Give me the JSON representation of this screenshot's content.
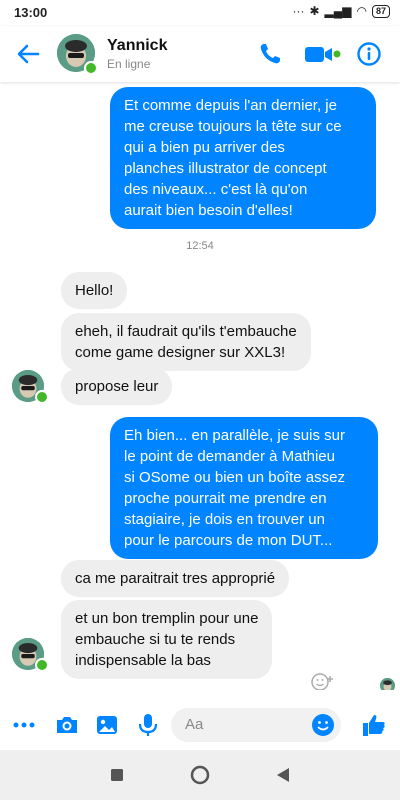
{
  "status_bar": {
    "time": "13:00",
    "battery": "87"
  },
  "header": {
    "contact_name": "Yannick",
    "contact_status": "En ligne"
  },
  "messages": [
    {
      "id": "m1",
      "side": "out",
      "lines": [
        "Et comme depuis l'an dernier, je",
        "me creuse toujours la tête sur ce",
        "qui a bien pu arriver des",
        "planches illustrator de concept",
        "des niveaux... c'est là qu'on",
        "aurait bien besoin d'elles!"
      ]
    },
    {
      "id": "m2",
      "side": "in",
      "lines": [
        "Hello!"
      ]
    },
    {
      "id": "m3",
      "side": "in",
      "lines": [
        "eheh, il faudrait qu'ils t'embauche",
        "come game designer sur XXL3!"
      ]
    },
    {
      "id": "m4",
      "side": "in",
      "lines": [
        "propose leur"
      ]
    },
    {
      "id": "m5",
      "side": "out",
      "lines": [
        "Eh bien... en parallèle, je suis sur",
        "le point de demander à Mathieu",
        "si OSome ou bien un boîte assez",
        "proche pourrait me prendre en",
        "stagiaire, je dois en trouver un",
        "pour le parcours de mon DUT..."
      ]
    },
    {
      "id": "m6",
      "side": "in",
      "lines": [
        "ca me paraitrait tres approprié"
      ]
    },
    {
      "id": "m7",
      "side": "in",
      "lines": [
        "et un bon tremplin pour une",
        "embauche si tu te rends",
        "indispensable la bas"
      ]
    }
  ],
  "timestamp": "12:54",
  "composer": {
    "placeholder": "Aa"
  },
  "colors": {
    "accent": "#0084ff",
    "incoming_bubble": "#eeeeee",
    "online": "#42b72a"
  },
  "icons": {
    "header": [
      "back-arrow-icon",
      "phone-icon",
      "video-icon",
      "info-icon"
    ],
    "composer": [
      "more-icon",
      "camera-icon",
      "gallery-icon",
      "microphone-icon",
      "emoji-icon",
      "thumbs-up-icon"
    ],
    "nav": [
      "recent-apps-icon",
      "home-icon",
      "back-icon"
    ]
  }
}
